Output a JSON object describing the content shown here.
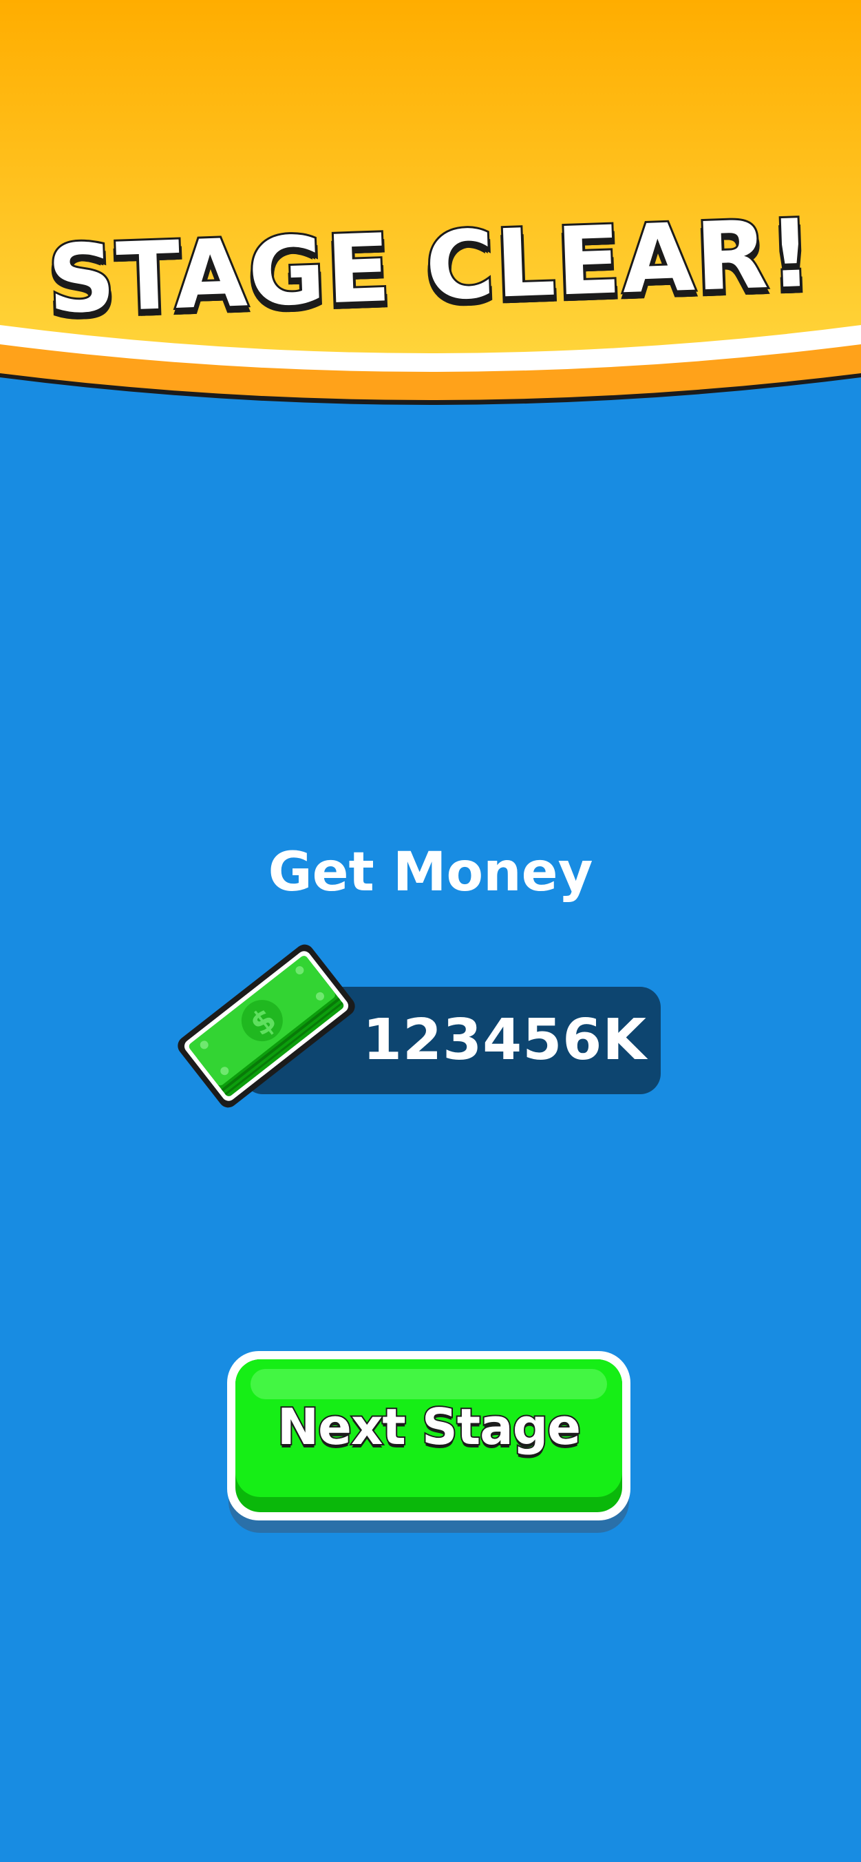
{
  "header": {
    "title": "STAGE CLEAR!"
  },
  "reward": {
    "label": "Get Money",
    "amount": "123456K",
    "icon": "money-bill-icon"
  },
  "actions": {
    "next_label": "Next Stage"
  },
  "colors": {
    "background": "#188ce2",
    "header_top": "#ffad00",
    "header_bottom": "#ffd43a",
    "header_trim": "#ffa21a",
    "money_panel": "#0d4570",
    "button_green": "#16ee16"
  }
}
